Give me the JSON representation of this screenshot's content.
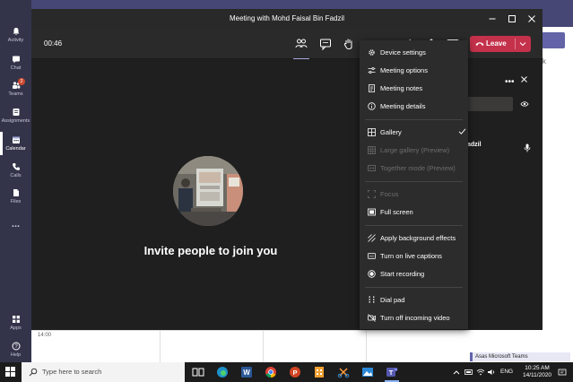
{
  "rail": {
    "items": [
      {
        "label": "Activity",
        "icon": "bell-icon"
      },
      {
        "label": "Chat",
        "icon": "chat-icon"
      },
      {
        "label": "Teams",
        "icon": "teams-icon",
        "badge": "2"
      },
      {
        "label": "Assignments",
        "icon": "assignments-icon"
      },
      {
        "label": "Calendar",
        "icon": "calendar-icon",
        "active": true
      },
      {
        "label": "Calls",
        "icon": "phone-icon"
      },
      {
        "label": "Files",
        "icon": "file-icon"
      },
      {
        "label": "...",
        "icon": "more-icon"
      },
      {
        "label": "Apps",
        "icon": "apps-icon"
      },
      {
        "label": "Help",
        "icon": "help-icon"
      }
    ]
  },
  "meeting": {
    "title": "Meeting with Mohd Faisal Bin Fadzil",
    "timer": "00:46",
    "leave_label": "Leave",
    "invite_text": "Invite people to join you"
  },
  "panel": {
    "participant_name": "adzil",
    "more": "•••"
  },
  "menu": {
    "items": [
      {
        "label": "Device settings",
        "icon": "gear-icon",
        "disabled": false
      },
      {
        "label": "Meeting options",
        "icon": "sliders-icon",
        "disabled": false
      },
      {
        "label": "Meeting notes",
        "icon": "notes-icon",
        "disabled": false
      },
      {
        "label": "Meeting details",
        "icon": "info-icon",
        "disabled": false
      },
      {
        "label": "Gallery",
        "icon": "gallery-icon",
        "disabled": false,
        "checked": true
      },
      {
        "label": "Large gallery (Preview)",
        "icon": "large-gallery-icon",
        "disabled": true
      },
      {
        "label": "Together mode (Preview)",
        "icon": "together-mode-icon",
        "disabled": true
      },
      {
        "label": "Focus",
        "icon": "focus-icon",
        "disabled": true
      },
      {
        "label": "Full screen",
        "icon": "fullscreen-icon",
        "disabled": false
      },
      {
        "label": "Apply background effects",
        "icon": "background-effects-icon",
        "disabled": false
      },
      {
        "label": "Turn on live captions",
        "icon": "captions-icon",
        "disabled": false
      },
      {
        "label": "Start recording",
        "icon": "record-icon",
        "disabled": false
      },
      {
        "label": "Dial pad",
        "icon": "dialpad-icon",
        "disabled": false
      },
      {
        "label": "Turn off incoming video",
        "icon": "video-off-icon",
        "disabled": false
      }
    ]
  },
  "calendar": {
    "time_label": "14:00",
    "event_label": "Asas Microsoft Teams",
    "week_fragment": "eek"
  },
  "taskbar": {
    "search_placeholder": "Type here to search",
    "language": "ENG",
    "time": "10:25 AM",
    "date": "14/11/2020"
  },
  "colors": {
    "teams_rail": "#33344a",
    "teams_purple": "#6264a7",
    "leave_red": "#c4314b",
    "meeting_bg": "#1f1f1f",
    "menu_bg": "#2d2c2c"
  }
}
